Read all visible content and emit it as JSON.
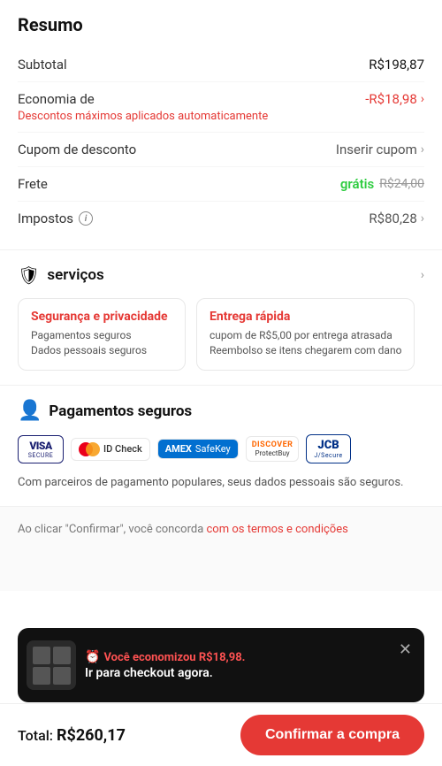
{
  "page": {
    "title": "Resumo"
  },
  "resumo": {
    "title": "Resumo",
    "subtotal_label": "Subtotal",
    "subtotal_value": "R$198,87",
    "economia_label": "Economia de",
    "economia_link": "Descontos máximos aplicados automaticamente",
    "economia_value": "-R$18,98",
    "cupom_label": "Cupom de desconto",
    "cupom_value": "Inserir cupom",
    "frete_label": "Frete",
    "frete_gratis": "grátis",
    "frete_original": "R$24,00",
    "impostos_label": "Impostos",
    "impostos_value": "R$80,28"
  },
  "services": {
    "title": "serviços",
    "card1_title": "Segurança e privacidade",
    "card1_item1": "Pagamentos seguros",
    "card1_item2": "Dados pessoais seguros",
    "card2_title": "Entrega rápida",
    "card2_item1": "cupom de R$5,00 por entrega atrasada",
    "card2_item2": "Reembolso se itens chegarem com dano"
  },
  "pagamentos": {
    "title": "Pagamentos seguros",
    "badges": {
      "visa_text": "VISA",
      "visa_secure": "SECURE",
      "idcheck": "ID Check",
      "amex_text": "AMEX",
      "safekey": "SafeKey",
      "discover_top": "DISCOVER",
      "discover_bottom": "ProtectBuy",
      "jcb_top": "JCB",
      "jcb_bottom": "J/Secure"
    },
    "description": "Com parceiros de pagamento populares, seus dados pessoais são seguros."
  },
  "terms": {
    "text_start": "Ao clicar \"Confirma...",
    "text_link": "com os termos e c..."
  },
  "bottom": {
    "total_label": "Total: ",
    "total_value": "R$260,17",
    "confirm_label": "Confirmar a compra"
  },
  "toast": {
    "title_prefix": "Você economizou",
    "amount": "R$18,98.",
    "message": "Ir para checkout agora."
  }
}
